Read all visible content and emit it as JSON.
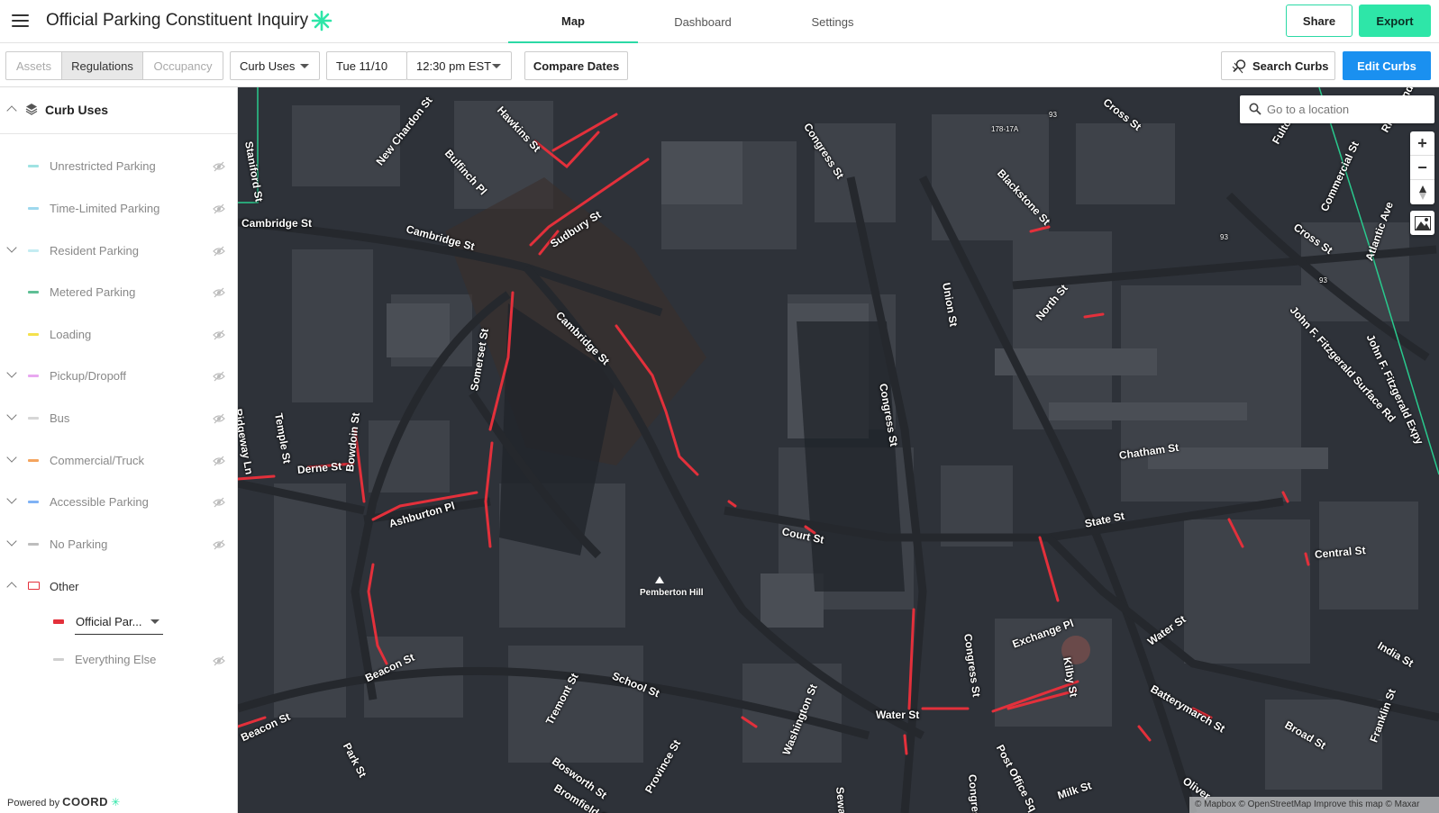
{
  "app": {
    "title": "Official Parking Constituent Inquiry"
  },
  "nav": {
    "tabs": [
      {
        "label": "Map"
      },
      {
        "label": "Dashboard"
      },
      {
        "label": "Settings"
      }
    ]
  },
  "header": {
    "share_label": "Share",
    "export_label": "Export"
  },
  "toolbar": {
    "segments": [
      "Assets",
      "Regulations",
      "Occupancy"
    ],
    "layer_select": "Curb Uses",
    "date": "Tue 11/10",
    "time": "12:30 pm EST",
    "compare_label": "Compare Dates",
    "search_curbs_label": "Search Curbs",
    "edit_curbs_label": "Edit Curbs"
  },
  "sidebar": {
    "title": "Curb Uses",
    "categories": [
      {
        "label": "Unrestricted Parking",
        "color": "#9fe3e3"
      },
      {
        "label": "Time-Limited Parking",
        "color": "#9ed8ee"
      },
      {
        "label": "Resident Parking",
        "color": "#c4ecf2"
      },
      {
        "label": "Metered Parking",
        "color": "#5fbf95"
      },
      {
        "label": "Loading",
        "color": "#f4e14c"
      },
      {
        "label": "Pickup/Dropoff",
        "color": "#e8a8f0"
      },
      {
        "label": "Bus",
        "color": "#d6d6d6"
      },
      {
        "label": "Commercial/Truck",
        "color": "#f4a45e"
      },
      {
        "label": "Accessible Parking",
        "color": "#7fb2f5"
      },
      {
        "label": "No Parking",
        "color": "#bdbdbd"
      },
      {
        "label": "Other",
        "color": "#e3303b"
      }
    ],
    "other_items": [
      {
        "label": "Official Par...",
        "color": "#e3303b"
      },
      {
        "label": "Everything Else",
        "color": "#cfcfcf"
      }
    ],
    "powered_by": "Powered by",
    "brand": "COORD"
  },
  "map": {
    "search_placeholder": "Go to a location",
    "zoom_in": "+",
    "zoom_out": "−",
    "attribution": "© Mapbox © OpenStreetMap Improve this map © Maxar",
    "poi": "Pemberton Hill",
    "streets": [
      "Hawkins St",
      "New Chardon St",
      "Bulfinch Pl",
      "Staniford St",
      "Cambridge St",
      "Cambridge St",
      "Sudbury St",
      "Congress St",
      "Blackstone St",
      "Cross St",
      "Cross St",
      "Fulton",
      "Commercial St",
      "Atlantic Ave",
      "Union St",
      "North St",
      "John F. Fitzgerald Surface Rd",
      "Cambridge St",
      "Somerset St",
      "Ridgeway Ln",
      "Temple St",
      "Bowdoin St",
      "Derne St",
      "Ashburton Pl",
      "Congress St",
      "Court St",
      "Chatham St",
      "State St",
      "Central St",
      "India St",
      "Beacon St",
      "Beacon St",
      "School St",
      "Tremont St",
      "Washington St",
      "Water St",
      "Water St",
      "Exchange Pl",
      "Kilby St",
      "Congress St",
      "Batterymarch St",
      "Broad St",
      "Franklin St",
      "Post Office Sq",
      "Park St",
      "Bosworth St",
      "Province St",
      "Bromfield St",
      "Milk St",
      "Oliver",
      "Sewall",
      "Congress",
      "John F. Fitzgerald Expy",
      "Richmond St"
    ],
    "small_labels": [
      "93",
      "93",
      "93",
      "178-17A"
    ]
  }
}
